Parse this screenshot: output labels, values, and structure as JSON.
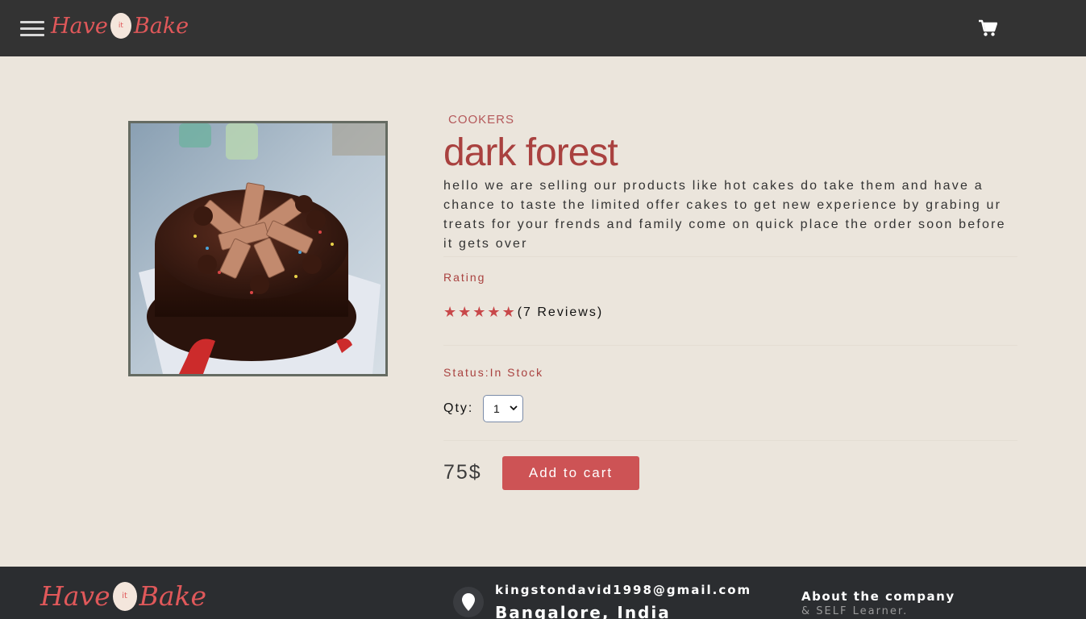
{
  "header": {
    "logo_left": "Have",
    "logo_mid": "it",
    "logo_right": "Bake",
    "menu_icon": "hamburger-menu-icon",
    "cart_icon": "shopping-cart-icon"
  },
  "product": {
    "category": "COOKERS",
    "title": "dark forest",
    "description": "hello we are selling our products like hot cakes do take them and have a chance to taste the limited offer cakes to get new experience by grabing ur treats for your frends and family come on quick place the order soon before it gets over",
    "rating_label": "Rating",
    "rating_stars": 5,
    "star_glyph": "★",
    "reviews": "(7 Reviews)",
    "status": "Status:In Stock",
    "qty_label": "Qty:",
    "qty_value": "1",
    "price": "75$",
    "add_to_cart_label": "Add to cart"
  },
  "footer": {
    "logo_left": "Have",
    "logo_mid": "it",
    "logo_right": "Bake",
    "email": "kingstondavid1998@gmail.com",
    "city": "Bangalore, India",
    "about_title": "About the company",
    "about_sub": "& SELF Learner.",
    "location_icon": "map-pin-icon"
  },
  "colors": {
    "header_bg": "#333333",
    "page_bg": "#ebe5dc",
    "accent": "#cd5355",
    "title_color": "#a9413f",
    "footer_bg": "#2b2d30"
  }
}
